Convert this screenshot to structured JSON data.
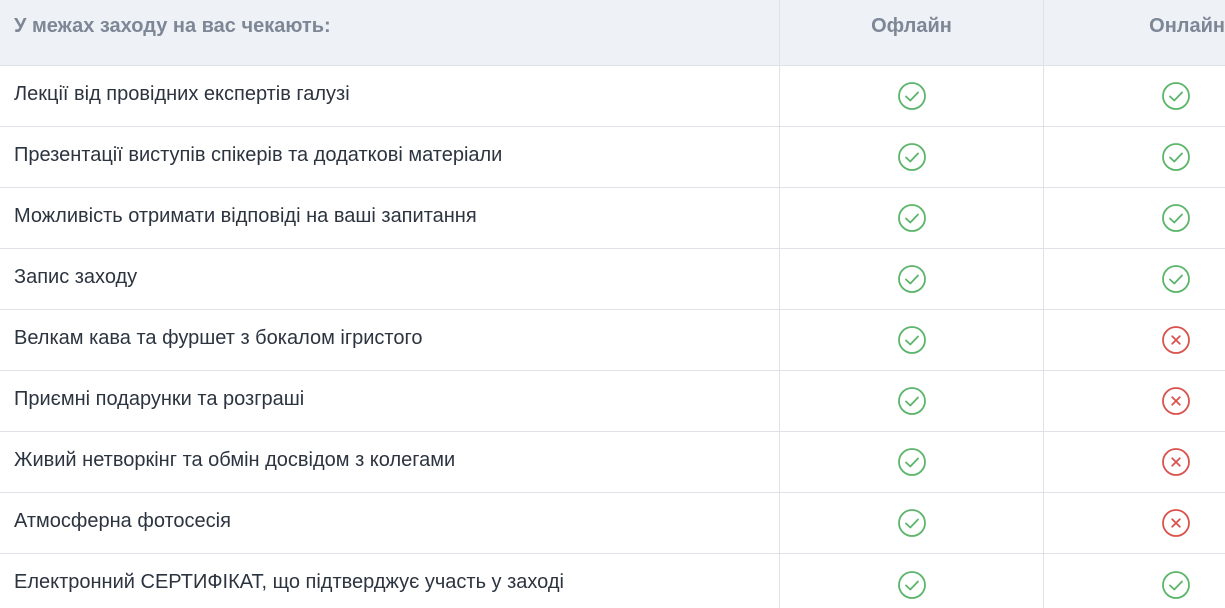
{
  "header": {
    "title": "У межах заходу на вас чекають:",
    "offline": "Офлайн",
    "online": "Онлайн"
  },
  "colors": {
    "check": "#5bb56a",
    "cross": "#d9534f",
    "header_bg": "#eef1f6",
    "header_text": "#7d8796",
    "border": "#dfe3e8"
  },
  "rows": [
    {
      "label": "Лекції від провідних експертів галузі",
      "offline": "check-icon",
      "online": "check-icon"
    },
    {
      "label": "Презентації виступів спікерів та додаткові матеріали",
      "offline": "check-icon",
      "online": "check-icon"
    },
    {
      "label": "Можливість отримати відповіді на ваші запитання",
      "offline": "check-icon",
      "online": "check-icon"
    },
    {
      "label": "Запис заходу",
      "offline": "check-icon",
      "online": "check-icon"
    },
    {
      "label": "Велкам кава та фуршет з бокалом ігристого",
      "offline": "check-icon",
      "online": "cross-icon"
    },
    {
      "label": "Приємні подарунки та розграші",
      "offline": "check-icon",
      "online": "cross-icon"
    },
    {
      "label": "Живий нетворкінг та обмін досвідом з колегами",
      "offline": "check-icon",
      "online": "cross-icon"
    },
    {
      "label": "Атмосферна фотосесія",
      "offline": "check-icon",
      "online": "cross-icon"
    },
    {
      "label": "Електронний СЕРТИФІКАТ, що підтверджує участь у заході",
      "offline": "check-icon",
      "online": "check-icon"
    }
  ]
}
